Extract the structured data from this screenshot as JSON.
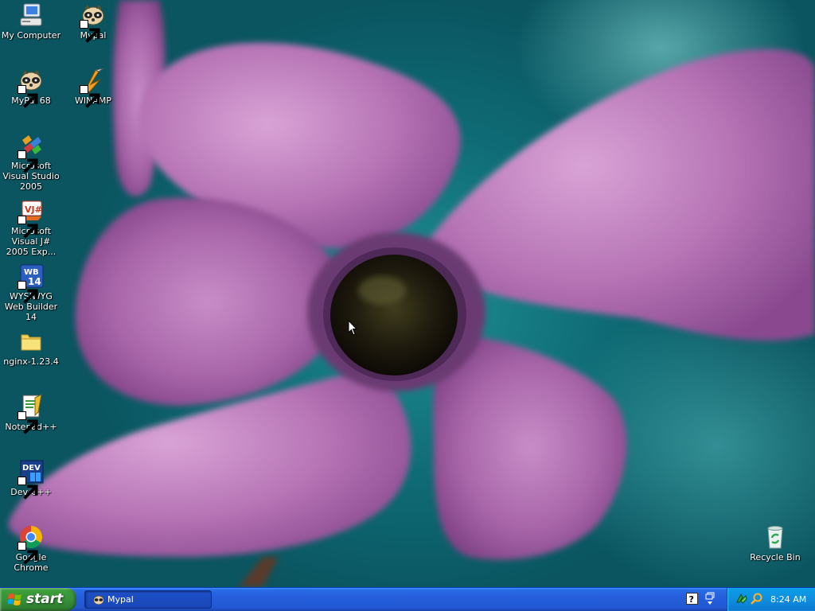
{
  "desktop": {
    "icons_left": [
      {
        "label": "My Computer",
        "icon": "my-computer-icon"
      },
      {
        "label": "MyPal 68",
        "icon": "mypal-icon"
      },
      {
        "label": "Microsoft Visual Studio 2005",
        "icon": "visual-studio-icon"
      },
      {
        "label": "Microsoft Visual J# 2005 Exp...",
        "icon": "visual-jsharp-icon"
      },
      {
        "label": "WYSIWYG Web Builder 14",
        "icon": "web-builder-icon"
      },
      {
        "label": "nginx-1.23.4",
        "icon": "folder-icon"
      },
      {
        "label": "Notepad++",
        "icon": "notepadpp-icon"
      },
      {
        "label": "Dev-C++",
        "icon": "devcpp-icon"
      },
      {
        "label": "Google Chrome",
        "icon": "chrome-icon"
      }
    ],
    "icons_second_column": [
      {
        "label": "Mypal",
        "icon": "mypal-icon"
      },
      {
        "label": "WINAMP",
        "icon": "winamp-icon"
      }
    ],
    "recycle_bin": {
      "label": "Recycle Bin",
      "icon": "recycle-bin-icon"
    }
  },
  "taskbar": {
    "start_label": "start",
    "tasks": [
      {
        "label": "Mypal",
        "icon": "mypal-icon"
      }
    ],
    "tray": {
      "clock": "8:24 AM",
      "icons": [
        "network-icon",
        "search-icon"
      ]
    }
  },
  "colors": {
    "taskbar_blue": "#245edb",
    "start_green": "#37913a",
    "tray_blue": "#0f8ddf",
    "wallpaper_teal": "#1f8f95",
    "petal_purple": "#b06fb2"
  }
}
